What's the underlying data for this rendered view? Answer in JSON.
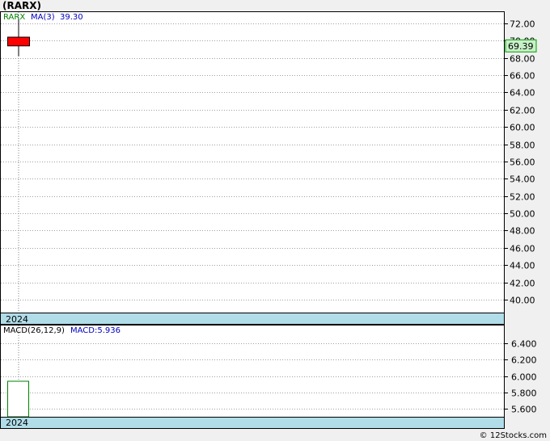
{
  "header": {
    "title": "(RARX)",
    "credit": "© 12Stocks.com"
  },
  "chart_data": [
    {
      "type": "candlestick",
      "symbol": "RARX",
      "legend": {
        "symbol_label": "RARX",
        "ma_label": "MA(3)",
        "ma_value": "39.30"
      },
      "ylim": [
        38.5,
        73.3
      ],
      "yticks": [
        40,
        42,
        44,
        46,
        48,
        50,
        52,
        54,
        56,
        58,
        60,
        62,
        64,
        66,
        68,
        70,
        72
      ],
      "ytick_labels": [
        "40.00",
        "42.00",
        "44.00",
        "46.00",
        "48.00",
        "50.00",
        "52.00",
        "54.00",
        "56.00",
        "58.00",
        "60.00",
        "62.00",
        "64.00",
        "66.00",
        "68.00",
        "70.00",
        "72.00"
      ],
      "last_price": "69.39",
      "year_label": "2024",
      "candles": [
        {
          "open": 70.4,
          "close": 69.39,
          "high": 72.5,
          "low": 68.2
        }
      ],
      "colors": {
        "down": "#ff0000",
        "price_box_bg": "#c8f0c8",
        "price_box_border": "#00a000",
        "symbol_label": "#008000",
        "ma_label": "#0000c0"
      }
    },
    {
      "type": "bar",
      "name": "MACD",
      "legend": {
        "params_label": "MACD(26,12,9)",
        "value_label": "MACD:5.936"
      },
      "ylim": [
        5.5,
        6.62
      ],
      "yticks": [
        5.6,
        5.8,
        6.0,
        6.2,
        6.4
      ],
      "ytick_labels": [
        "5.600",
        "5.800",
        "6.000",
        "6.200",
        "6.400"
      ],
      "year_label": "2024",
      "values": [
        5.936
      ],
      "colors": {
        "value_label": "#0000c0",
        "bar_stroke": "#008000"
      }
    }
  ]
}
